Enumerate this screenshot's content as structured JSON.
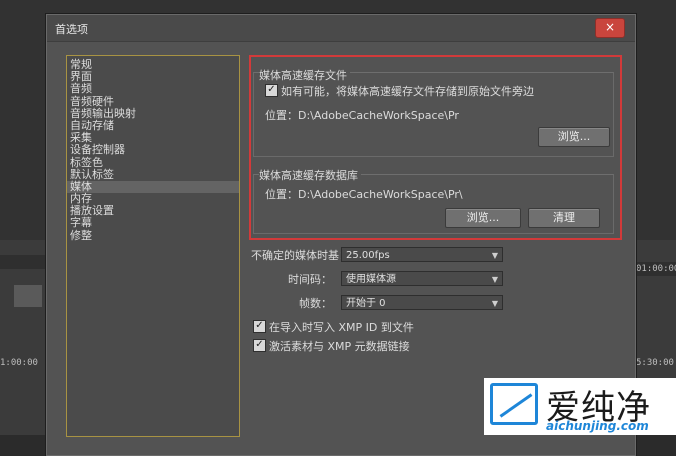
{
  "dialog": {
    "title": "首选项",
    "close_symbol": "×"
  },
  "sidebar": {
    "items": [
      {
        "label": "常规"
      },
      {
        "label": "界面"
      },
      {
        "label": "音频"
      },
      {
        "label": "音频硬件"
      },
      {
        "label": "音频输出映射"
      },
      {
        "label": "自动存储"
      },
      {
        "label": "采集"
      },
      {
        "label": "设备控制器"
      },
      {
        "label": "标签色"
      },
      {
        "label": "默认标签"
      },
      {
        "label": "媒体",
        "selected": true
      },
      {
        "label": "内存"
      },
      {
        "label": "播放设置"
      },
      {
        "label": "字幕"
      },
      {
        "label": "修整"
      }
    ]
  },
  "cache_files": {
    "label": "媒体高速缓存文件",
    "checkbox_label": "如有可能，将媒体高速缓存文件存储到原始文件旁边",
    "checked": true,
    "location": "位置：D:\\AdobeCacheWorkSpace\\Pr",
    "browse_button": "浏览..."
  },
  "cache_db": {
    "label": "媒体高速缓存数据库",
    "location": "位置：D:\\AdobeCacheWorkSpace\\Pr\\",
    "browse_button": "浏览...",
    "clean_button": "清理"
  },
  "settings": {
    "timebase_label": "不确定的媒体时基：",
    "timebase_value": "25.00fps",
    "timecode_label": "时间码：",
    "timecode_value": "使用媒体源",
    "frame_label": "帧数：",
    "frame_value": "开始于 0",
    "xmp_checkbox": "在导入时写入 XMP ID 到文件",
    "xmp_checked": true,
    "link_checkbox": "激活素材与 XMP 元数据链接",
    "link_checked": true
  },
  "background": {
    "timecode_right": "01:00:00",
    "timecode_left": "1:00:00",
    "timecode_bottom_right": "5:30:00"
  },
  "watermark": {
    "text": "爱纯净",
    "url": "aichunjing.com"
  },
  "colors": {
    "highlight": "#d23a3a",
    "sidebar_border": "#a89343",
    "close_button": "#c9453d",
    "watermark_blue": "#1e86d8"
  }
}
